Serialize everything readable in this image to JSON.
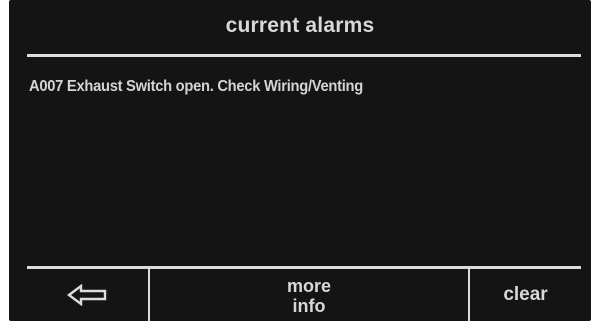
{
  "header": {
    "title": "current alarms"
  },
  "alarms": [
    {
      "text": "A007 Exhaust Switch open. Check Wiring/Venting"
    }
  ],
  "soft_keys": {
    "back_icon": "left-arrow-outline-icon",
    "more_info_line1": "more",
    "more_info_line2": "info",
    "clear_label": "clear"
  },
  "colors": {
    "screen_background": "#141414",
    "text": "#d8d8d8",
    "rules": "#dcdcdc"
  }
}
